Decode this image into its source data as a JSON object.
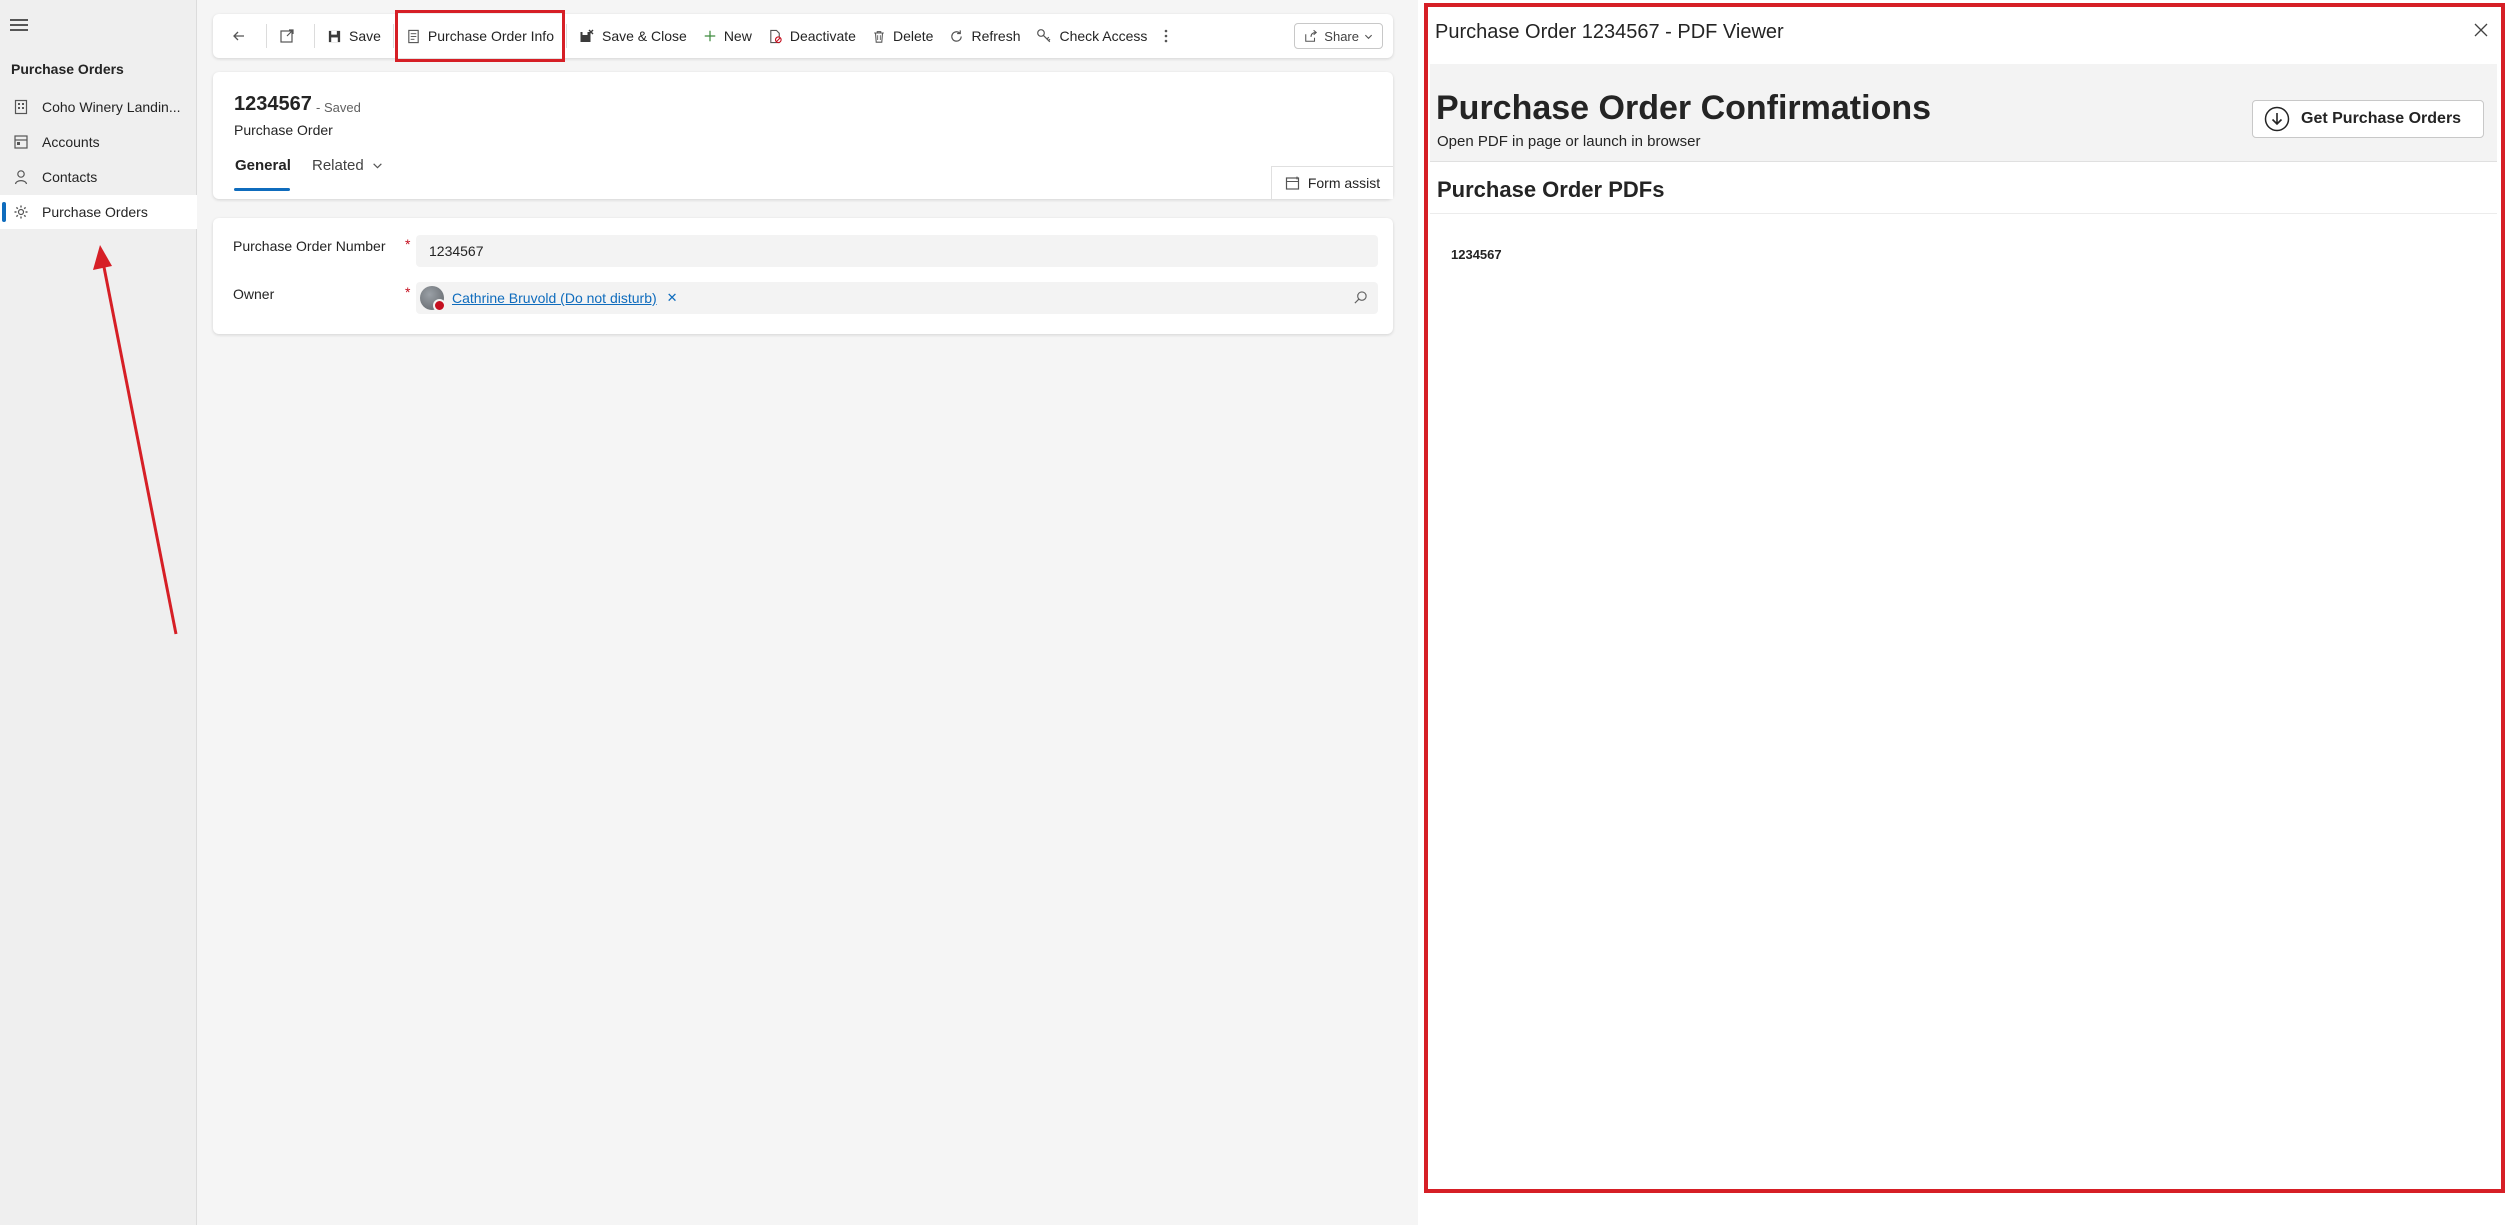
{
  "sidebar": {
    "heading": "Purchase Orders",
    "items": [
      {
        "label": "Coho Winery Landin...",
        "icon": "building-icon"
      },
      {
        "label": "Accounts",
        "icon": "accounts-icon"
      },
      {
        "label": "Contacts",
        "icon": "person-icon"
      },
      {
        "label": "Purchase Orders",
        "icon": "gear-icon",
        "active": true
      }
    ]
  },
  "toolbar": {
    "save_label": "Save",
    "purchase_order_info_label": "Purchase Order Info",
    "save_close_label": "Save & Close",
    "new_label": "New",
    "deactivate_label": "Deactivate",
    "delete_label": "Delete",
    "refresh_label": "Refresh",
    "check_access_label": "Check Access",
    "share_label": "Share"
  },
  "record": {
    "title": "1234567",
    "status": "- Saved",
    "entity": "Purchase Order",
    "tabs": [
      {
        "label": "General",
        "active": true
      },
      {
        "label": "Related"
      }
    ],
    "form_assist_label": "Form assist"
  },
  "fields": {
    "po_number_label": "Purchase Order Number",
    "po_number_value": "1234567",
    "owner_label": "Owner",
    "owner_value": "Cathrine Bruvold (Do not disturb)",
    "required_marker": "*"
  },
  "pdf_viewer": {
    "window_title": "Purchase Order 1234567 - PDF Viewer",
    "heading": "Purchase Order Confirmations",
    "subheading": "Open PDF in page or launch in browser",
    "get_button_label": "Get Purchase Orders",
    "section_title": "Purchase Order PDFs",
    "items": [
      "1234567"
    ]
  },
  "colors": {
    "accent": "#0f6cbd",
    "annotation": "#d61f26",
    "required": "#c50f1f"
  }
}
